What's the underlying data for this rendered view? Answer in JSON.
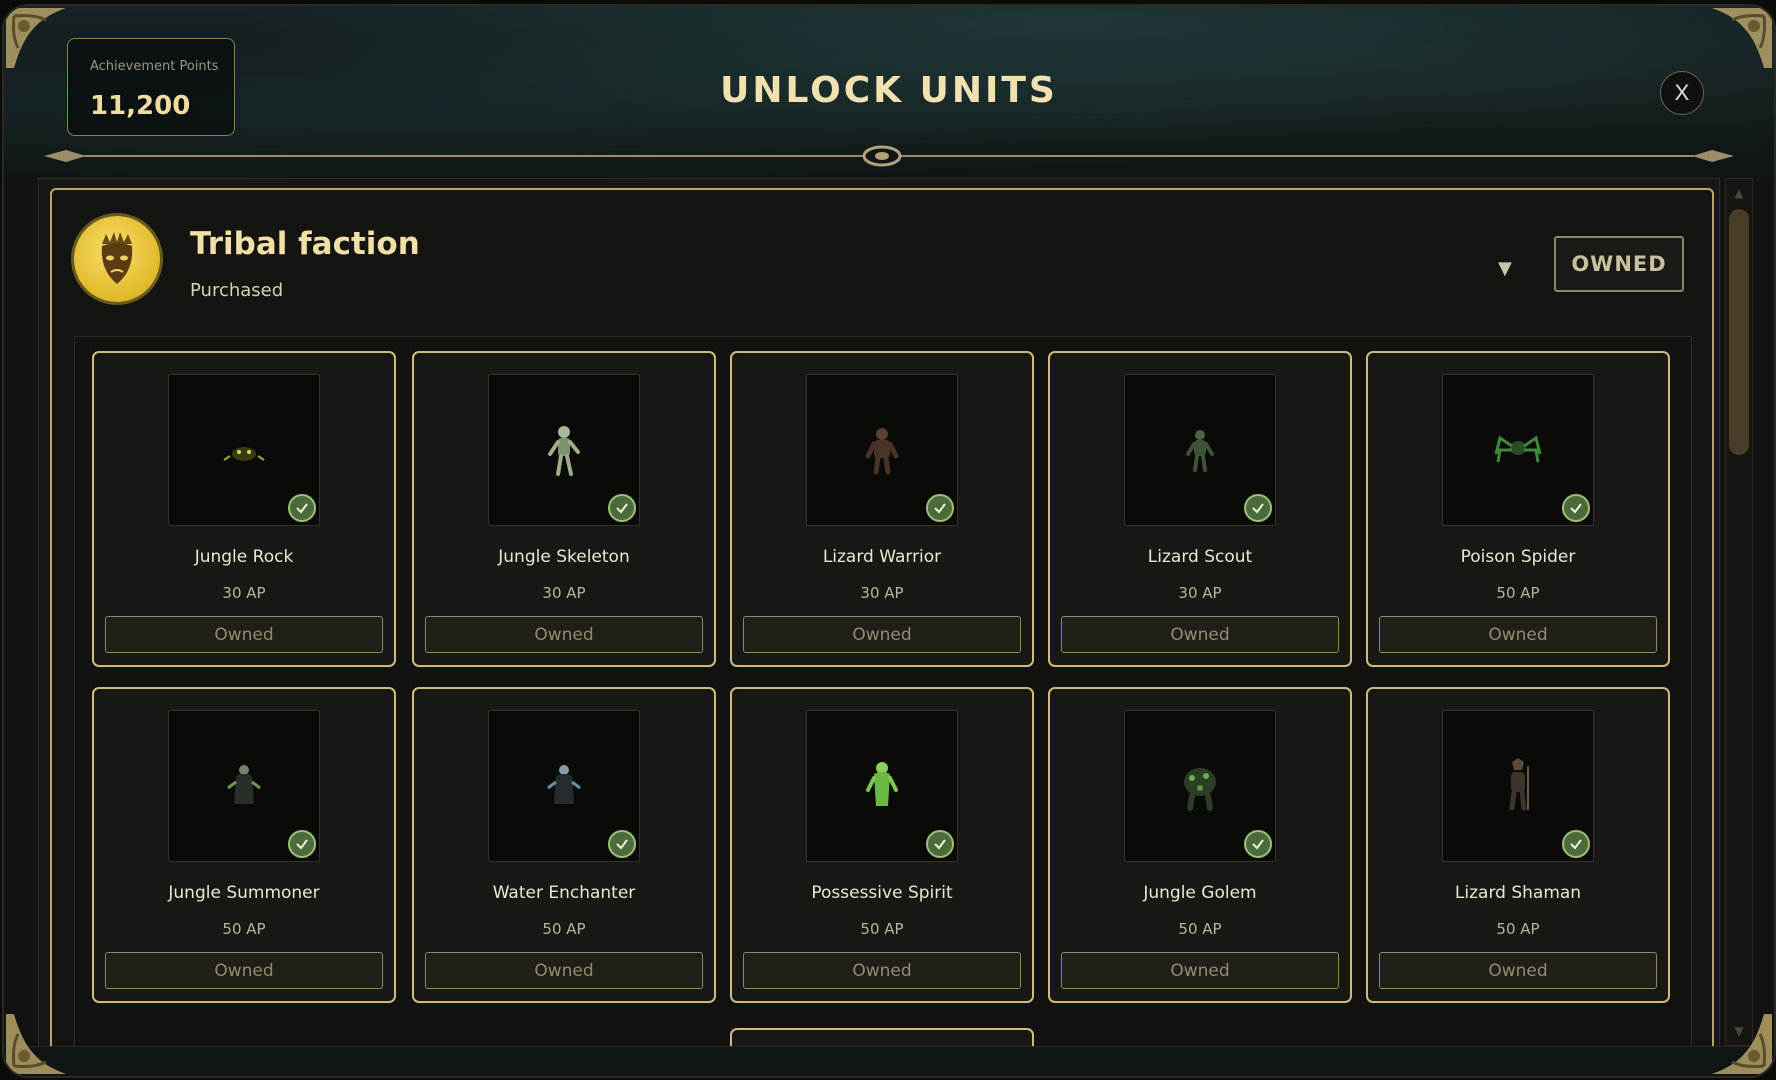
{
  "header": {
    "achievement_label": "Achievement Points",
    "achievement_value": "11,200",
    "title": "UNLOCK UNITS",
    "close_label": "X"
  },
  "faction": {
    "name": "Tribal faction",
    "status": "Purchased",
    "badge": "OWNED",
    "emblem_icon": "tribal-mask-icon"
  },
  "units": [
    {
      "name": "Jungle Rock",
      "cost": "30 AP",
      "button": "Owned",
      "owned": true
    },
    {
      "name": "Jungle Skeleton",
      "cost": "30 AP",
      "button": "Owned",
      "owned": true
    },
    {
      "name": "Lizard Warrior",
      "cost": "30 AP",
      "button": "Owned",
      "owned": true
    },
    {
      "name": "Lizard Scout",
      "cost": "30 AP",
      "button": "Owned",
      "owned": true
    },
    {
      "name": "Poison Spider",
      "cost": "50 AP",
      "button": "Owned",
      "owned": true
    },
    {
      "name": "Jungle Summoner",
      "cost": "50 AP",
      "button": "Owned",
      "owned": true
    },
    {
      "name": "Water Enchanter",
      "cost": "50 AP",
      "button": "Owned",
      "owned": true
    },
    {
      "name": "Possessive Spirit",
      "cost": "50 AP",
      "button": "Owned",
      "owned": true
    },
    {
      "name": "Jungle Golem",
      "cost": "50 AP",
      "button": "Owned",
      "owned": true
    },
    {
      "name": "Lizard Shaman",
      "cost": "50 AP",
      "button": "Owned",
      "owned": true
    }
  ],
  "colors": {
    "accent_gold": "#cdbb80",
    "title_gold": "#f1e1b0",
    "owned_check": "#4d6a3c",
    "emblem_gold": "#e1b928"
  }
}
